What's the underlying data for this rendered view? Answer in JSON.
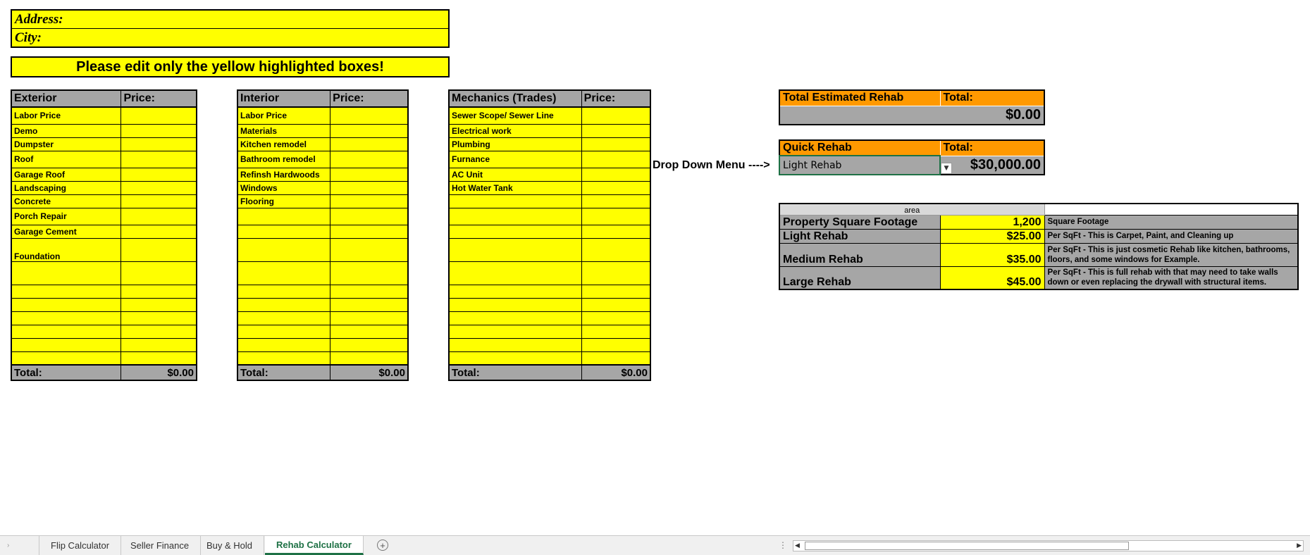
{
  "address_block": {
    "address_label": "Address:",
    "city_label": "City:"
  },
  "notice": "Please edit only the yellow highlighted boxes!",
  "exterior": {
    "header": "Exterior",
    "price_header": "Price:",
    "items": [
      "Labor Price",
      "Demo",
      "Dumpster",
      "Roof",
      "Garage Roof",
      "Landscaping",
      "Concrete",
      "Porch Repair",
      "Garage Cement",
      "Foundation",
      "",
      "",
      "",
      "",
      "",
      "",
      ""
    ],
    "total_label": "Total:",
    "total_value": "$0.00"
  },
  "interior": {
    "header": "Interior",
    "price_header": "Price:",
    "items": [
      "Labor Price",
      "Materials",
      "Kitchen remodel",
      "Bathroom remodel",
      "Refinsh Hardwoods",
      "Windows",
      "Flooring",
      "",
      "",
      "",
      "",
      "",
      "",
      "",
      "",
      "",
      ""
    ],
    "total_label": "Total:",
    "total_value": "$0.00"
  },
  "mechanics": {
    "header": "Mechanics (Trades)",
    "price_header": "Price:",
    "items": [
      "Sewer Scope/ Sewer Line",
      "Electrical work",
      "Plumbing",
      "Furnance",
      "AC Unit",
      "Hot Water Tank",
      "",
      "",
      "",
      "",
      "",
      "",
      "",
      "",
      "",
      "",
      ""
    ],
    "total_label": "Total:",
    "total_value": "$0.00"
  },
  "total_estimated": {
    "label": "Total Estimated Rehab",
    "total_header": "Total:",
    "value": "$0.00"
  },
  "quick_rehab": {
    "label": "Quick Rehab",
    "total_header": "Total:",
    "selected": "Light Rehab",
    "value": "$30,000.00",
    "dropdown_hint": "Drop Down Menu ---->"
  },
  "sqft_table": {
    "caption": "area",
    "rows": [
      {
        "label": "Property Square Footage",
        "value": "1,200",
        "desc": "Square Footage"
      },
      {
        "label": "Light Rehab",
        "value": "$25.00",
        "desc": "Per SqFt - This is Carpet, Paint, and Cleaning up"
      },
      {
        "label": "Medium Rehab",
        "value": "$35.00",
        "desc": "Per SqFt - This is just cosmetic Rehab like kitchen, bathrooms, floors, and some windows for Example."
      },
      {
        "label": "Large Rehab",
        "value": "$45.00",
        "desc": "Per SqFt - This is full rehab with that may need to take walls down or even replacing the drywall with structural items."
      }
    ]
  },
  "sheet_tabs": [
    "Flip Calculator",
    "Seller Finance",
    "Buy & Hold",
    "Rehab Calculator"
  ],
  "active_tab": "Rehab Calculator",
  "colors": {
    "highlight": "#ffff00",
    "header_gray": "#a6a6a6",
    "accent_orange": "#ff9900",
    "excel_green": "#1e7145"
  }
}
